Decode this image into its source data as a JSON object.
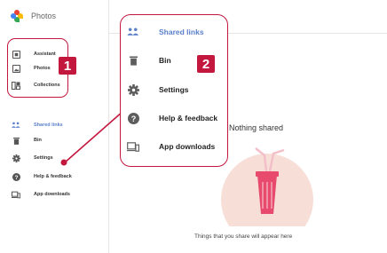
{
  "app": {
    "title": "Photos"
  },
  "sidebar": {
    "group1": [
      {
        "label": "Assistant",
        "icon": "assistant-icon"
      },
      {
        "label": "Photos",
        "icon": "photo-icon"
      },
      {
        "label": "Collections",
        "icon": "collections-icon"
      }
    ],
    "group2": [
      {
        "label": "Shared links",
        "icon": "shared-links-icon",
        "active": true
      },
      {
        "label": "Bin",
        "icon": "bin-icon"
      },
      {
        "label": "Settings",
        "icon": "gear-icon"
      },
      {
        "label": "Help & feedback",
        "icon": "help-icon"
      },
      {
        "label": "App downloads",
        "icon": "devices-icon"
      }
    ]
  },
  "zoom_menu": {
    "items": [
      {
        "label": "Shared links",
        "icon": "shared-links-icon",
        "active": true
      },
      {
        "label": "Bin",
        "icon": "bin-icon"
      },
      {
        "label": "Settings",
        "icon": "gear-icon"
      },
      {
        "label": "Help & feedback",
        "icon": "help-icon"
      },
      {
        "label": "App downloads",
        "icon": "devices-icon"
      }
    ]
  },
  "badges": {
    "one": "1",
    "two": "2"
  },
  "main": {
    "empty_title": "Nothing shared",
    "empty_caption": "Things that you share will appear here"
  },
  "colors": {
    "accent": "#c3173e",
    "active_text": "#5a7fc9",
    "illustration_bg": "#f7ded7",
    "cup": "#e84a6d"
  }
}
